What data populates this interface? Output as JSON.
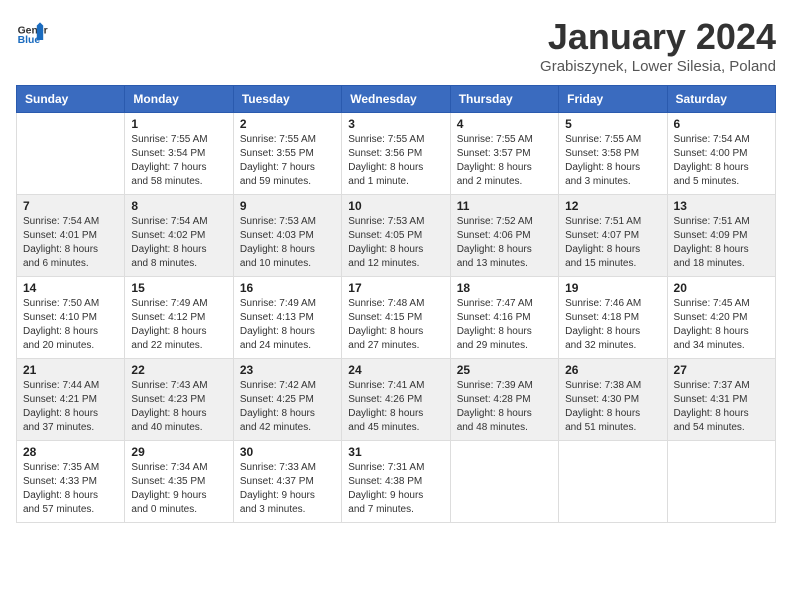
{
  "header": {
    "logo_general": "General",
    "logo_blue": "Blue",
    "month_title": "January 2024",
    "location": "Grabiszynek, Lower Silesia, Poland"
  },
  "calendar": {
    "days_of_week": [
      "Sunday",
      "Monday",
      "Tuesday",
      "Wednesday",
      "Thursday",
      "Friday",
      "Saturday"
    ],
    "weeks": [
      [
        {
          "day": "",
          "info": ""
        },
        {
          "day": "1",
          "info": "Sunrise: 7:55 AM\nSunset: 3:54 PM\nDaylight: 7 hours\nand 58 minutes."
        },
        {
          "day": "2",
          "info": "Sunrise: 7:55 AM\nSunset: 3:55 PM\nDaylight: 7 hours\nand 59 minutes."
        },
        {
          "day": "3",
          "info": "Sunrise: 7:55 AM\nSunset: 3:56 PM\nDaylight: 8 hours\nand 1 minute."
        },
        {
          "day": "4",
          "info": "Sunrise: 7:55 AM\nSunset: 3:57 PM\nDaylight: 8 hours\nand 2 minutes."
        },
        {
          "day": "5",
          "info": "Sunrise: 7:55 AM\nSunset: 3:58 PM\nDaylight: 8 hours\nand 3 minutes."
        },
        {
          "day": "6",
          "info": "Sunrise: 7:54 AM\nSunset: 4:00 PM\nDaylight: 8 hours\nand 5 minutes."
        }
      ],
      [
        {
          "day": "7",
          "info": "Sunrise: 7:54 AM\nSunset: 4:01 PM\nDaylight: 8 hours\nand 6 minutes."
        },
        {
          "day": "8",
          "info": "Sunrise: 7:54 AM\nSunset: 4:02 PM\nDaylight: 8 hours\nand 8 minutes."
        },
        {
          "day": "9",
          "info": "Sunrise: 7:53 AM\nSunset: 4:03 PM\nDaylight: 8 hours\nand 10 minutes."
        },
        {
          "day": "10",
          "info": "Sunrise: 7:53 AM\nSunset: 4:05 PM\nDaylight: 8 hours\nand 12 minutes."
        },
        {
          "day": "11",
          "info": "Sunrise: 7:52 AM\nSunset: 4:06 PM\nDaylight: 8 hours\nand 13 minutes."
        },
        {
          "day": "12",
          "info": "Sunrise: 7:51 AM\nSunset: 4:07 PM\nDaylight: 8 hours\nand 15 minutes."
        },
        {
          "day": "13",
          "info": "Sunrise: 7:51 AM\nSunset: 4:09 PM\nDaylight: 8 hours\nand 18 minutes."
        }
      ],
      [
        {
          "day": "14",
          "info": "Sunrise: 7:50 AM\nSunset: 4:10 PM\nDaylight: 8 hours\nand 20 minutes."
        },
        {
          "day": "15",
          "info": "Sunrise: 7:49 AM\nSunset: 4:12 PM\nDaylight: 8 hours\nand 22 minutes."
        },
        {
          "day": "16",
          "info": "Sunrise: 7:49 AM\nSunset: 4:13 PM\nDaylight: 8 hours\nand 24 minutes."
        },
        {
          "day": "17",
          "info": "Sunrise: 7:48 AM\nSunset: 4:15 PM\nDaylight: 8 hours\nand 27 minutes."
        },
        {
          "day": "18",
          "info": "Sunrise: 7:47 AM\nSunset: 4:16 PM\nDaylight: 8 hours\nand 29 minutes."
        },
        {
          "day": "19",
          "info": "Sunrise: 7:46 AM\nSunset: 4:18 PM\nDaylight: 8 hours\nand 32 minutes."
        },
        {
          "day": "20",
          "info": "Sunrise: 7:45 AM\nSunset: 4:20 PM\nDaylight: 8 hours\nand 34 minutes."
        }
      ],
      [
        {
          "day": "21",
          "info": "Sunrise: 7:44 AM\nSunset: 4:21 PM\nDaylight: 8 hours\nand 37 minutes."
        },
        {
          "day": "22",
          "info": "Sunrise: 7:43 AM\nSunset: 4:23 PM\nDaylight: 8 hours\nand 40 minutes."
        },
        {
          "day": "23",
          "info": "Sunrise: 7:42 AM\nSunset: 4:25 PM\nDaylight: 8 hours\nand 42 minutes."
        },
        {
          "day": "24",
          "info": "Sunrise: 7:41 AM\nSunset: 4:26 PM\nDaylight: 8 hours\nand 45 minutes."
        },
        {
          "day": "25",
          "info": "Sunrise: 7:39 AM\nSunset: 4:28 PM\nDaylight: 8 hours\nand 48 minutes."
        },
        {
          "day": "26",
          "info": "Sunrise: 7:38 AM\nSunset: 4:30 PM\nDaylight: 8 hours\nand 51 minutes."
        },
        {
          "day": "27",
          "info": "Sunrise: 7:37 AM\nSunset: 4:31 PM\nDaylight: 8 hours\nand 54 minutes."
        }
      ],
      [
        {
          "day": "28",
          "info": "Sunrise: 7:35 AM\nSunset: 4:33 PM\nDaylight: 8 hours\nand 57 minutes."
        },
        {
          "day": "29",
          "info": "Sunrise: 7:34 AM\nSunset: 4:35 PM\nDaylight: 9 hours\nand 0 minutes."
        },
        {
          "day": "30",
          "info": "Sunrise: 7:33 AM\nSunset: 4:37 PM\nDaylight: 9 hours\nand 3 minutes."
        },
        {
          "day": "31",
          "info": "Sunrise: 7:31 AM\nSunset: 4:38 PM\nDaylight: 9 hours\nand 7 minutes."
        },
        {
          "day": "",
          "info": ""
        },
        {
          "day": "",
          "info": ""
        },
        {
          "day": "",
          "info": ""
        }
      ]
    ]
  }
}
